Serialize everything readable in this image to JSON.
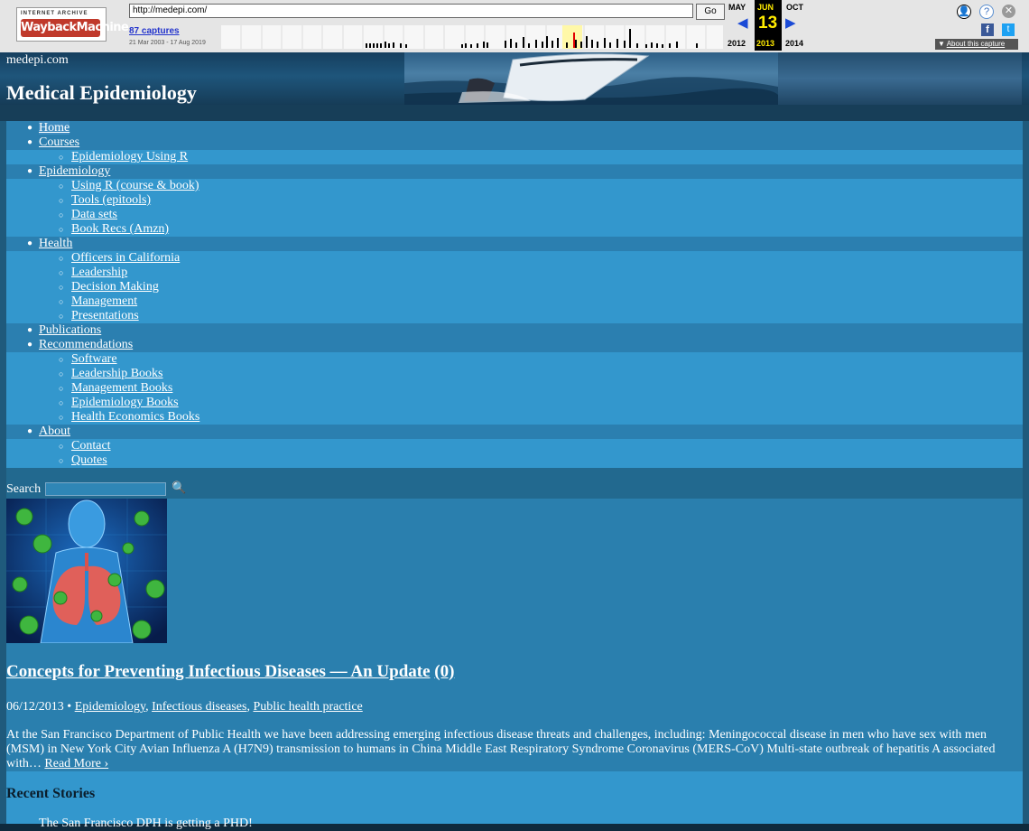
{
  "wayback": {
    "logo_top": "INTERNET ARCHIVE",
    "logo_main": "WaybackMachine",
    "url": "http://medepi.com/",
    "go_label": "Go",
    "captures": "87 captures",
    "range": "21 Mar 2003 - 17 Aug 2019",
    "prev_month": "MAY",
    "cur_month": "JUN",
    "next_month": "OCT",
    "cur_day": "13",
    "prev_year": "2012",
    "cur_year": "2013",
    "next_year": "2014",
    "about": "About this capture"
  },
  "header": {
    "site_small": "medepi.com",
    "site_title": "Medical Epidemiology"
  },
  "nav": {
    "home": "Home",
    "courses": "Courses",
    "courses_r": "Epidemiology Using R",
    "epidemiology": "Epidemiology",
    "epi_r": "Using R (course & book)",
    "epi_tools": "Tools (epitools)",
    "epi_data": "Data sets",
    "epi_books": "Book Recs (Amzn)",
    "health": "Health",
    "h_officers": "Officers in California",
    "h_leadership": "Leadership",
    "h_decision": "Decision Making",
    "h_management": "Management",
    "h_presentations": "Presentations",
    "publications": "Publications",
    "recommendations": "Recommendations",
    "r_software": "Software",
    "r_leadership": "Leadership Books",
    "r_management": "Management Books",
    "r_epi": "Epidemiology Books",
    "r_health_econ": "Health Economics Books",
    "about": "About",
    "a_contact": "Contact",
    "a_quotes": "Quotes"
  },
  "search": {
    "label": "Search",
    "value": ""
  },
  "post": {
    "title": "Concepts for Preventing Infectious Diseases — An Update",
    "comments": "(0)",
    "date": "06/12/2013 •",
    "cat1": "Epidemiology",
    "cat2": "Infectious diseases",
    "cat3": "Public health practice",
    "excerpt": "At the San Francisco Department of Public Health we have been addressing emerging infectious disease threats and challenges, including: Meningococcal disease in men who have sex with men (MSM) in New York City Avian Influenza A (H7N9) transmission to humans in China Middle East Respiratory Syndrome Coronavirus (MERS-CoV) Multi-state outbreak of hepatitis A associated with…",
    "read_more": "Read More ›"
  },
  "recent": {
    "heading": "Recent Stories",
    "first_item": "The San Francisco DPH is getting a PHD!"
  }
}
